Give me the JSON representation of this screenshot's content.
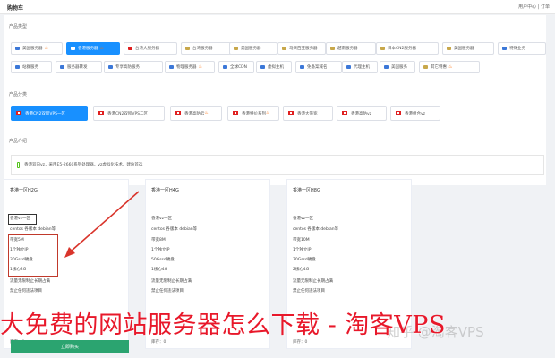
{
  "header": {
    "title": "购物车",
    "user_links": "用户中心 | 订单"
  },
  "product_types": {
    "label": "产品类型",
    "items": [
      {
        "label": "美国服务器",
        "icon_color": "#3c78d8",
        "hot": true
      },
      {
        "label": "香港服务器",
        "icon_color": "#ffffff",
        "hot": true,
        "active": true
      },
      {
        "label": "台湾大服务器",
        "icon_color": "#e02020",
        "hot": false
      },
      {
        "label": "台湾服务器",
        "icon_color": "#c8a84b",
        "hot": false
      },
      {
        "label": "美国服务器",
        "icon_color": "#c8a84b",
        "hot": false
      },
      {
        "label": "马来西亚服务器",
        "icon_color": "#c8a84b",
        "hot": false
      },
      {
        "label": "越南服务器",
        "icon_color": "#c8a84b",
        "hot": false
      },
      {
        "label": "日本CN2服务器",
        "icon_color": "#c8a84b",
        "hot": false
      },
      {
        "label": "美国服务器",
        "icon_color": "#c8a84b",
        "hot": false
      },
      {
        "label": "特殊业务",
        "icon_color": "#3c78d8",
        "hot": false
      },
      {
        "label": "站群服务",
        "icon_color": "#3c78d8",
        "hot": false
      },
      {
        "label": "服务器转发",
        "icon_color": "#3c78d8",
        "hot": false
      },
      {
        "label": "专享高防服务",
        "icon_color": "#3c78d8",
        "hot": false
      },
      {
        "label": "物理服务器",
        "icon_color": "#3c78d8",
        "hot": true
      },
      {
        "label": "全球CDN",
        "icon_color": "#3c78d8",
        "hot": false
      },
      {
        "label": "虚拟主机",
        "icon_color": "#3c78d8",
        "hot": false
      },
      {
        "label": "免备案域名",
        "icon_color": "#3c78d8",
        "hot": false
      },
      {
        "label": "代理主机",
        "icon_color": "#3c78d8",
        "hot": false
      },
      {
        "label": "美国服务",
        "icon_color": "#3c78d8",
        "hot": false
      },
      {
        "label": "其它特惠",
        "icon_color": "#c8a84b",
        "hot": true
      }
    ]
  },
  "product_categories": {
    "label": "产品分类",
    "items": [
      {
        "label": "香港CN2双程VPS一区",
        "active": true
      },
      {
        "label": "香港CN2双程VPS二区",
        "active": false
      },
      {
        "label": "香港高防云",
        "active": false,
        "hot": true
      },
      {
        "label": "香港特价系列",
        "active": false,
        "hot": true
      },
      {
        "label": "香港大带宽",
        "active": false
      },
      {
        "label": "香港高防vz",
        "active": false
      },
      {
        "label": "香港组合vz",
        "active": false
      }
    ]
  },
  "intro": {
    "label": "产品介绍",
    "text": "香港双向vz，采用E5-2660系列处理器，vz虚拟化技术。建站首选"
  },
  "cards": [
    {
      "title": "香港一区H2G",
      "rows": [
        "香港vz一区",
        "centos 各版本 debian等",
        "带宽5M",
        "1个独立IP",
        "30Gssd硬盘",
        "1核心2G",
        "流量无限制止长期占满",
        "禁止任何违法项目"
      ],
      "price": "库存：0"
    },
    {
      "title": "香港一区H4G",
      "rows": [
        "香港vz一区",
        "centos 各版本 debian等",
        "带宽8M",
        "1个独立IP",
        "50Gssd硬盘",
        "1核心4G",
        "流量无限制止长期占满",
        "禁止任何违法项目"
      ],
      "price": "库存：0"
    },
    {
      "title": "香港一区H8G",
      "rows": [
        "香港vz一区",
        "centos 各版本 debian等",
        "带宽10M",
        "1个独立IP",
        "70Gssd硬盘",
        "2核心4G",
        "流量无限制止长期占满",
        "禁止任何违法项目"
      ],
      "price": "库存：0"
    }
  ],
  "buy_button": "立即购买",
  "overlay": {
    "caption": "大免费的网站服务器怎么下载 - 淘客VPS",
    "watermark": "知乎 @淘客VPS"
  },
  "colors": {
    "accent": "#1890ff",
    "hot": "#ff6a00",
    "caption": "#e8182a",
    "buy": "#2ba470"
  }
}
